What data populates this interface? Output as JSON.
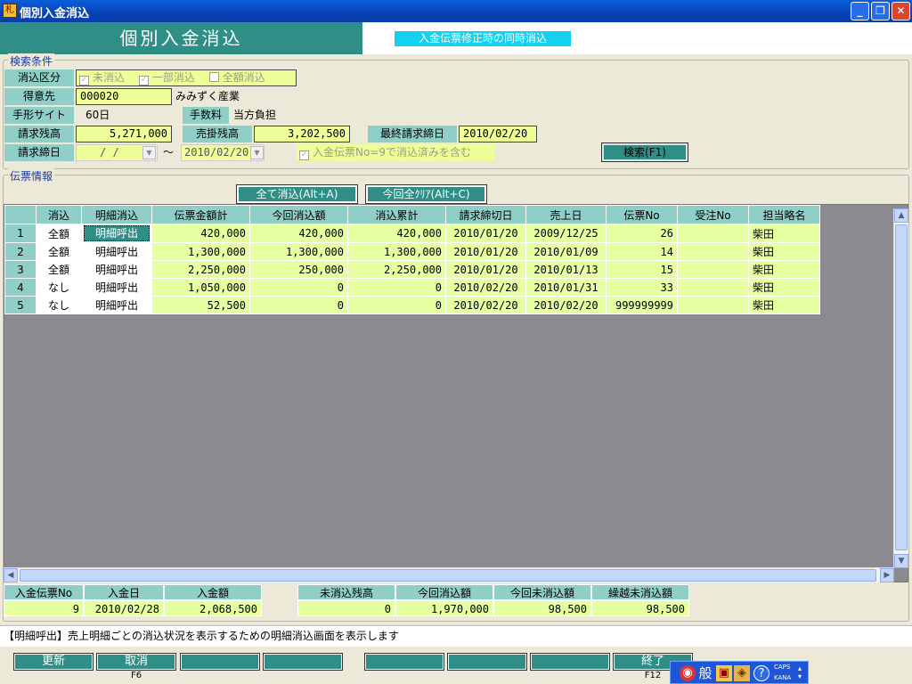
{
  "window": {
    "title": "個別入金消込",
    "app_icon": "app-icon"
  },
  "header": {
    "title": "個別入金消込",
    "note": "入金伝票修正時の同時消込"
  },
  "search": {
    "group_label": "検索条件",
    "kind_label": "消込区分",
    "kind_options": [
      {
        "label": "未消込",
        "checked": true
      },
      {
        "label": "一部消込",
        "checked": true
      },
      {
        "label": "全額消込",
        "checked": false
      }
    ],
    "customer_label": "得意先",
    "customer_code": "000020",
    "customer_name": "みみずく産業",
    "tegata_label": "手形サイト",
    "tegata_value": "60日",
    "fee_label": "手数料",
    "fee_value": "当方負担",
    "claim_balance_label": "請求残高",
    "claim_balance": "5,271,000",
    "ar_balance_label": "売掛残高",
    "ar_balance": "3,202,500",
    "last_close_label": "最終請求締日",
    "last_close": "2010/02/20",
    "close_date_label": "請求締日",
    "close_from": " /  / ",
    "range_sep": "〜",
    "close_to": "2010/02/20",
    "include_label": "入金伝票No=9で消込済みを含む",
    "include_checked": true,
    "search_button": "検索(F1)"
  },
  "slip": {
    "group_label": "伝票情報",
    "clear_all_button": "全て消込(Alt+A)",
    "clear_current_button": "今回全ｸﾘｱ(Alt+C)",
    "columns": [
      "",
      "消込",
      "明細消込",
      "伝票金額計",
      "今回消込額",
      "消込累計",
      "請求締切日",
      "売上日",
      "伝票No",
      "受注No",
      "担当略名"
    ],
    "rows": [
      {
        "no": "1",
        "kind": "全額",
        "detail": "明細呼出",
        "total": "420,000",
        "current": "420,000",
        "cumulative": "420,000",
        "close": "2010/01/20",
        "sale": "2009/12/25",
        "slip_no": "26",
        "order_no": "",
        "staff": "柴田"
      },
      {
        "no": "2",
        "kind": "全額",
        "detail": "明細呼出",
        "total": "1,300,000",
        "current": "1,300,000",
        "cumulative": "1,300,000",
        "close": "2010/01/20",
        "sale": "2010/01/09",
        "slip_no": "14",
        "order_no": "",
        "staff": "柴田"
      },
      {
        "no": "3",
        "kind": "全額",
        "detail": "明細呼出",
        "total": "2,250,000",
        "current": "250,000",
        "cumulative": "2,250,000",
        "close": "2010/01/20",
        "sale": "2010/01/13",
        "slip_no": "15",
        "order_no": "",
        "staff": "柴田"
      },
      {
        "no": "4",
        "kind": "なし",
        "detail": "明細呼出",
        "total": "1,050,000",
        "current": "0",
        "cumulative": "0",
        "close": "2010/02/20",
        "sale": "2010/01/31",
        "slip_no": "33",
        "order_no": "",
        "staff": "柴田"
      },
      {
        "no": "5",
        "kind": "なし",
        "detail": "明細呼出",
        "total": "52,500",
        "current": "0",
        "cumulative": "0",
        "close": "2010/02/20",
        "sale": "2010/02/20",
        "slip_no": "999999999",
        "order_no": "",
        "staff": "柴田"
      }
    ]
  },
  "summary": {
    "left": [
      {
        "label": "入金伝票No",
        "value": "9"
      },
      {
        "label": "入金日",
        "value": "2010/02/28"
      },
      {
        "label": "入金額",
        "value": "2,068,500"
      }
    ],
    "right": [
      {
        "label": "未消込残高",
        "value": "0"
      },
      {
        "label": "今回消込額",
        "value": "1,970,000"
      },
      {
        "label": "今回未消込額",
        "value": "98,500"
      },
      {
        "label": "繰越未消込額",
        "value": "98,500"
      }
    ]
  },
  "help": "【明細呼出】売上明細ごとの消込状況を表示するための明細消込画面を表示します",
  "fkeys": {
    "update": "更新",
    "cancel": "取消",
    "cancel_key": "F6",
    "exit": "終了",
    "exit_key": "F12"
  },
  "ime": {
    "mode": "般",
    "caps": "CAPS",
    "kana": "KANA"
  },
  "colors": {
    "teal": "#2f8f87",
    "light_teal": "#8fcfc7",
    "field_yellow": "#eeff9a",
    "cyan_note": "#14d2ef"
  }
}
